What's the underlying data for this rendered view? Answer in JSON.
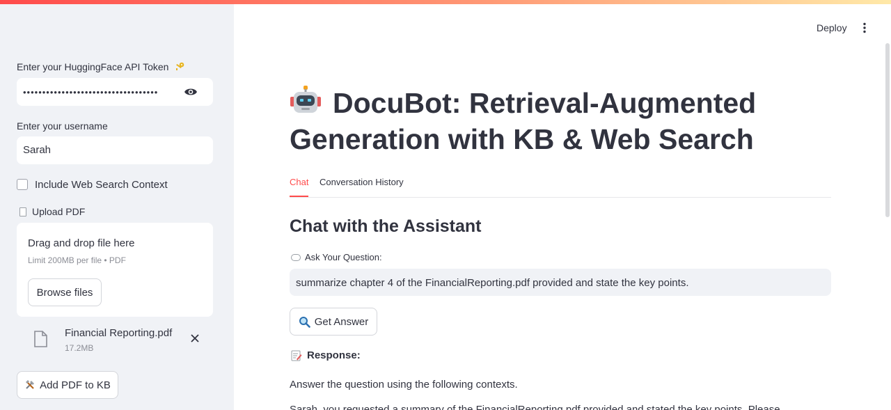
{
  "header": {
    "deploy_label": "Deploy",
    "menu_icon": "kebab-icon"
  },
  "sidebar": {
    "token_label": "Enter your HuggingFace API Token",
    "token_value": "•••••••••••••••••••••••••••••••••••",
    "username_label": "Enter your username",
    "username_value": "Sarah",
    "web_search_label": "Include Web Search Context",
    "web_search_checked": false,
    "upload_label": "Upload PDF",
    "dropzone_title": "Drag and drop file here",
    "dropzone_hint": "Limit 200MB per file • PDF",
    "browse_label": "Browse files",
    "file": {
      "name": "Financial Reporting.pdf",
      "size": "17.2MB"
    },
    "add_pdf_label": "Add PDF to KB"
  },
  "main": {
    "title": "DocuBot: Retrieval-Augmented Generation with KB & Web Search",
    "tabs": [
      {
        "label": "Chat",
        "active": true
      },
      {
        "label": "Conversation History",
        "active": false
      }
    ],
    "chat_heading": "Chat with the Assistant",
    "ask_label": "Ask Your Question:",
    "question_value": "summarize chapter 4 of the FinancialReporting.pdf provided and state the key points.",
    "get_answer_label": "Get Answer",
    "response_label": "Response:",
    "answer_line": "Answer the question using the following contexts.",
    "answer_partial": "Sarah, you requested a summary of the FinancialReporting.pdf provided and stated the key points. Please"
  },
  "colors": {
    "accent": "#ff4b4b",
    "sidebar_bg": "#f0f2f6",
    "text": "#31333f"
  }
}
